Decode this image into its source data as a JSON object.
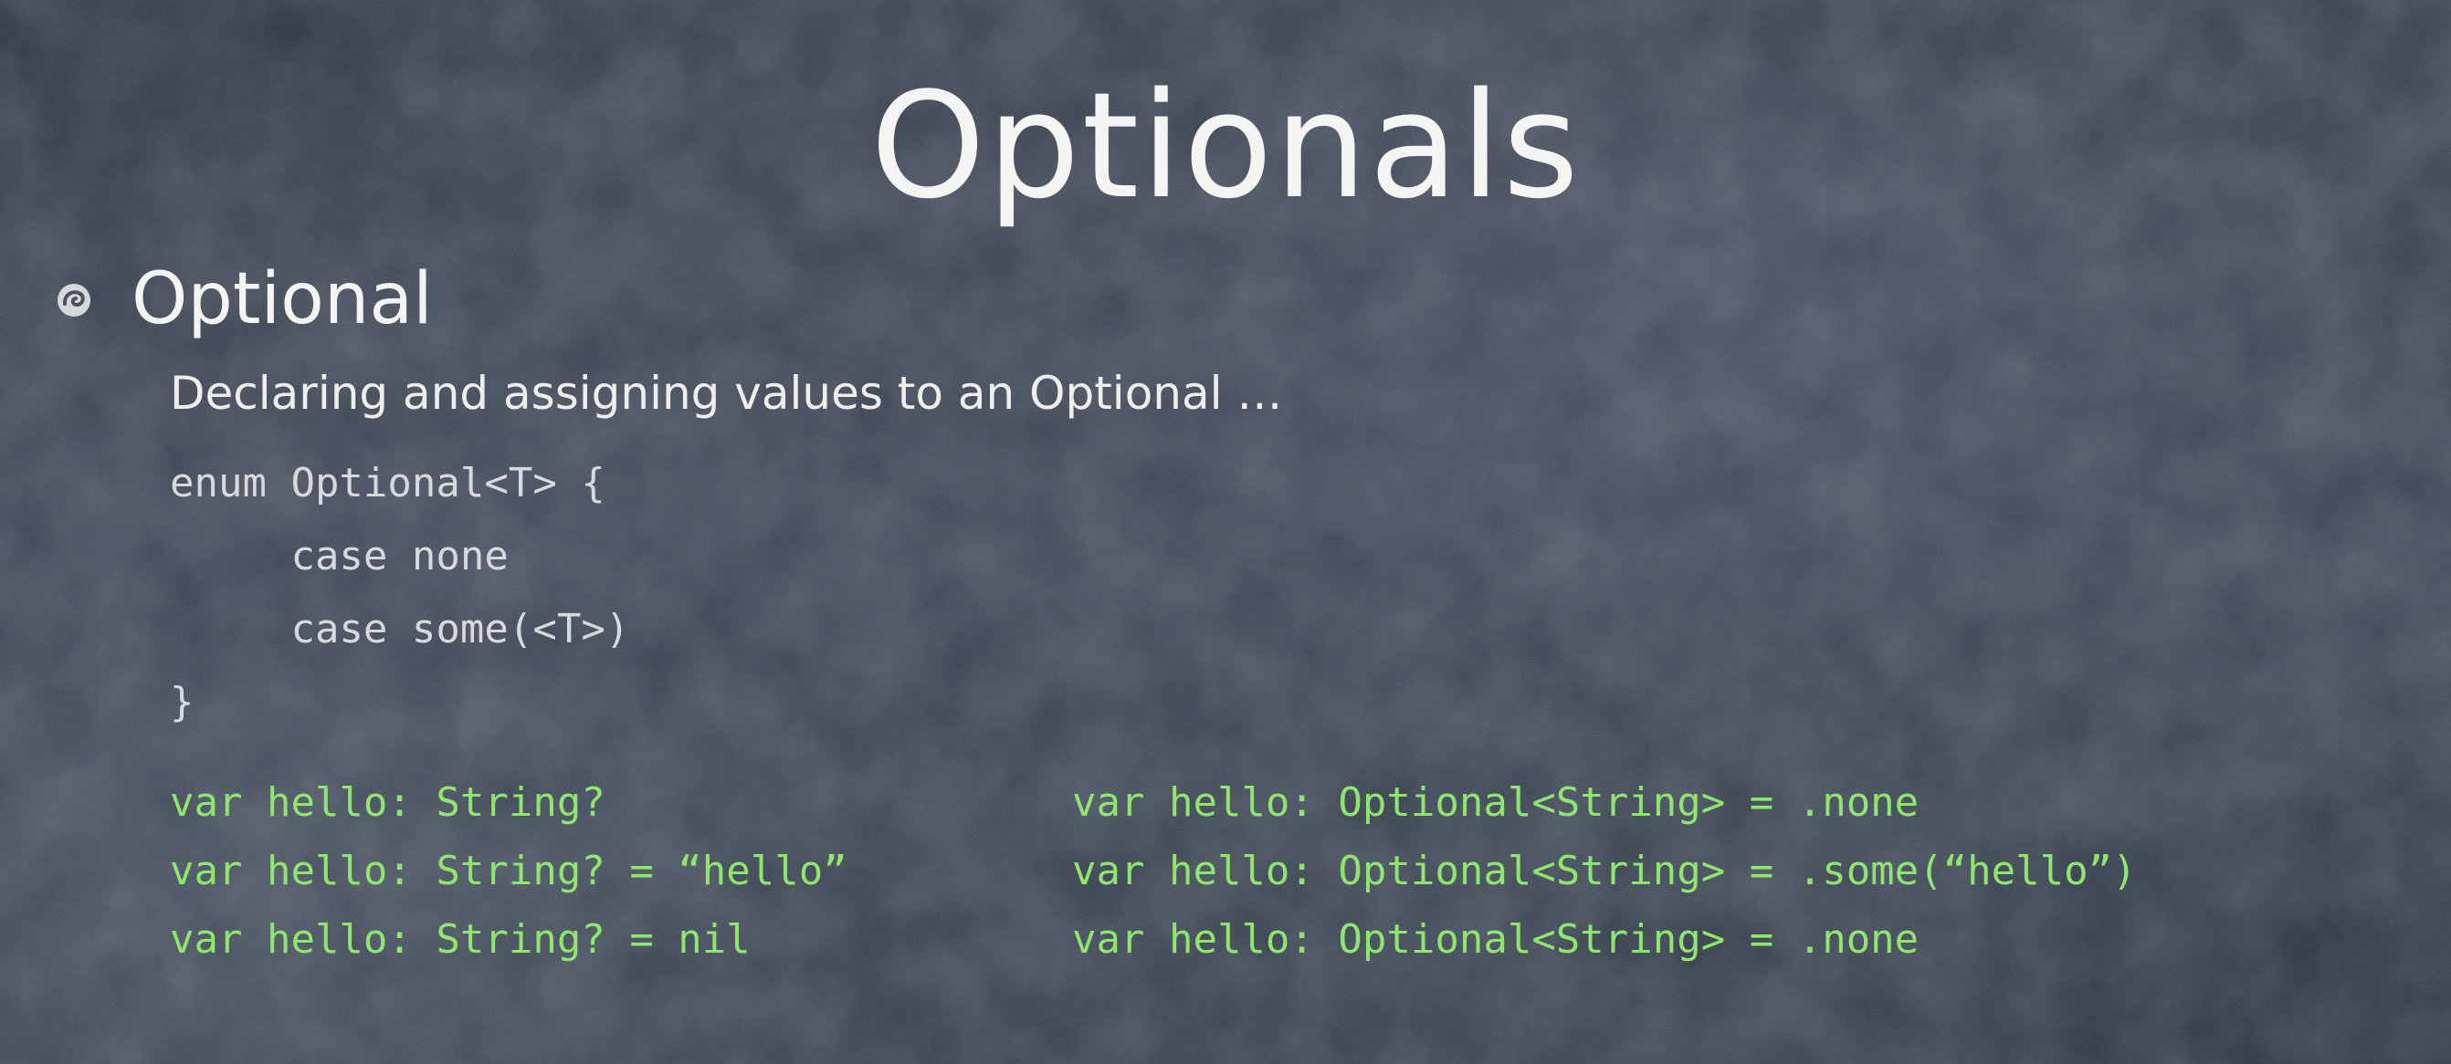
{
  "slide": {
    "title": "Optionals",
    "bullet": "Optional",
    "subtitle": "Declaring and assigning values to an Optional …",
    "enum_code": [
      "enum Optional<T> {",
      "     case none",
      "     case some(<T>)",
      "}"
    ],
    "examples_left": [
      "var hello: String?",
      "var hello: String? = “hello”",
      "var hello: String? = nil"
    ],
    "examples_right": [
      "var hello: Optional<String> = .none",
      "var hello: Optional<String> = .some(“hello”)",
      "var hello: Optional<String> = .none"
    ]
  },
  "colors": {
    "background": "#3f4756",
    "text": "#f4f4f2",
    "code": "#d8d9dc",
    "code_green": "#8fe66e"
  },
  "icons": {
    "bullet": "chalk-swirl-bullet-icon"
  }
}
